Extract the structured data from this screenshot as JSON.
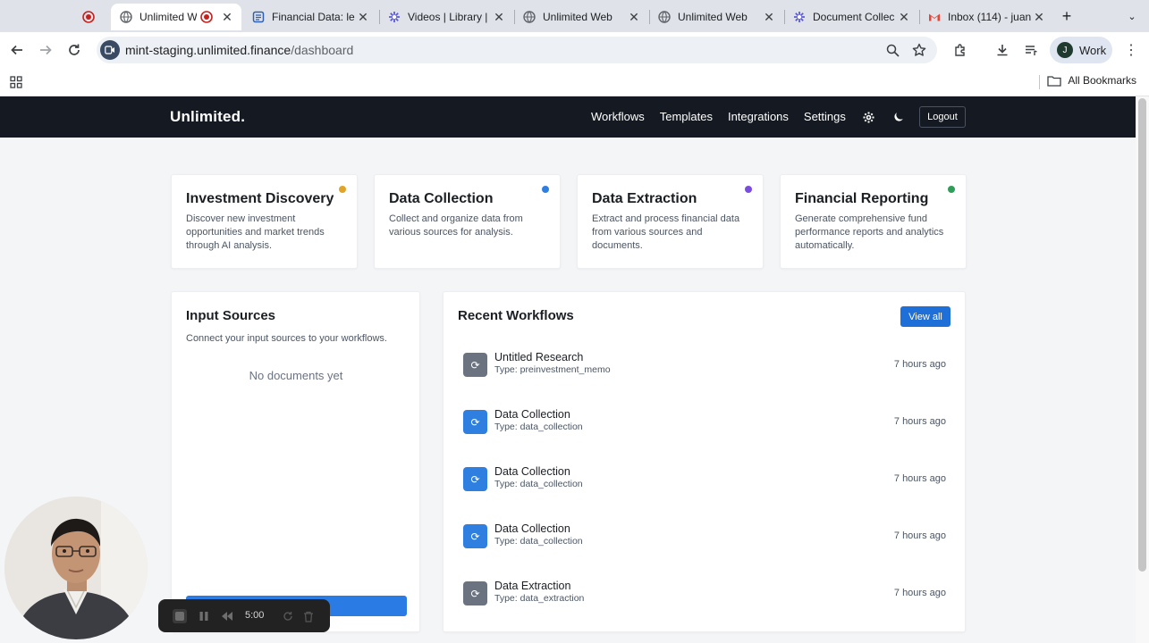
{
  "browser": {
    "tabs": [
      {
        "title": "",
        "favicon": "record-icon"
      },
      {
        "title": "Unlimited Web",
        "favicon": "globe-icon",
        "active": true
      },
      {
        "title": "Financial Data: le",
        "favicon": "doc-icon"
      },
      {
        "title": "Videos | Library |",
        "favicon": "loom-icon"
      },
      {
        "title": "Unlimited Web",
        "favicon": "globe-icon"
      },
      {
        "title": "Unlimited Web",
        "favicon": "globe-icon"
      },
      {
        "title": "Document Collec",
        "favicon": "loom-icon"
      },
      {
        "title": "Inbox (114) - juan",
        "favicon": "gmail-icon"
      }
    ],
    "new_tab_symbol": "+",
    "url_host": "mint-staging.unlimited.finance",
    "url_path": "/dashboard",
    "profile_initial": "J",
    "profile_label": "Work",
    "bookmarks_label": "All Bookmarks"
  },
  "app": {
    "brand": "Unlimited.",
    "nav": [
      "Workflows",
      "Templates",
      "Integrations",
      "Settings"
    ],
    "logout_label": "Logout",
    "feature_cards": [
      {
        "title": "Investment Discovery",
        "description": "Discover new investment opportunities and market trends through AI analysis.",
        "dot_color": "#e0a526"
      },
      {
        "title": "Data Collection",
        "description": "Collect and organize data from various sources for analysis.",
        "dot_color": "#2f7fe0"
      },
      {
        "title": "Data Extraction",
        "description": "Extract and process financial data from various sources and documents.",
        "dot_color": "#7b4ce0"
      },
      {
        "title": "Financial Reporting",
        "description": "Generate comprehensive fund performance reports and analytics automatically.",
        "dot_color": "#2e9e58"
      }
    ],
    "input_sources": {
      "title": "Input Sources",
      "subtitle": "Connect your input sources to your workflows.",
      "empty_text": "No documents yet"
    },
    "recent_workflows": {
      "title": "Recent Workflows",
      "view_all_label": "View all",
      "items": [
        {
          "name": "Untitled Research",
          "type": "Type: preinvestment_memo",
          "time": "7 hours ago",
          "icon_color": "#6b7280"
        },
        {
          "name": "Data Collection",
          "type": "Type: data_collection",
          "time": "7 hours ago",
          "icon_color": "#2f7fe0"
        },
        {
          "name": "Data Collection",
          "type": "Type: data_collection",
          "time": "7 hours ago",
          "icon_color": "#2f7fe0"
        },
        {
          "name": "Data Collection",
          "type": "Type: data_collection",
          "time": "7 hours ago",
          "icon_color": "#2f7fe0"
        },
        {
          "name": "Data Extraction",
          "type": "Type: data_extraction",
          "time": "7 hours ago",
          "icon_color": "#6b7280"
        }
      ]
    }
  },
  "recorder": {
    "time": "5:00"
  }
}
